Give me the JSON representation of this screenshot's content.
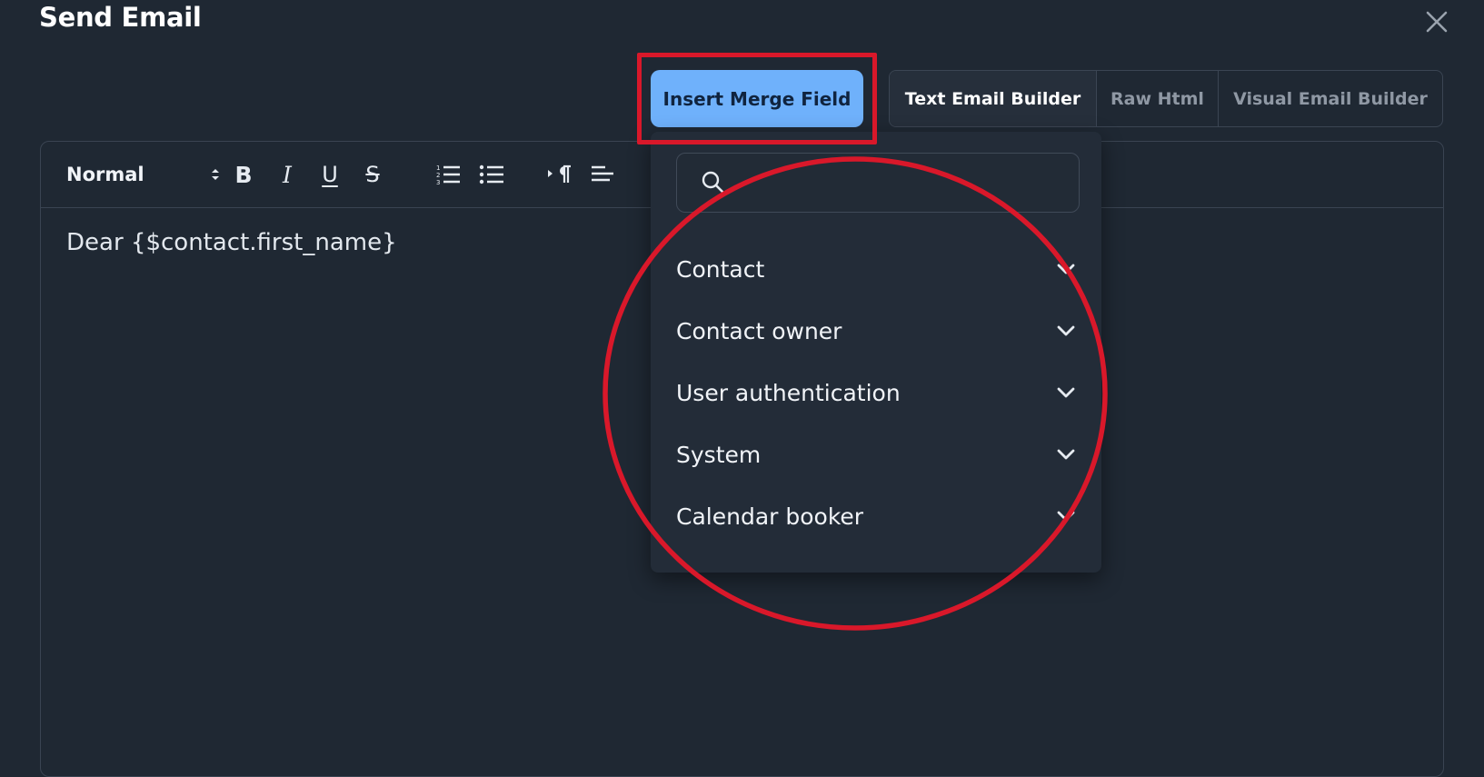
{
  "modal": {
    "title": "Send Email",
    "close_icon": "close-icon"
  },
  "insert_merge_button": "Insert Merge Field",
  "mode_tabs": [
    {
      "label": "Text Email Builder",
      "active": true
    },
    {
      "label": "Raw Html",
      "active": false
    },
    {
      "label": "Visual Email Builder",
      "active": false
    }
  ],
  "toolbar": {
    "format_value": "Normal",
    "buttons": [
      {
        "icon": "bold-icon",
        "glyph": "B"
      },
      {
        "icon": "italic-icon",
        "glyph": "I"
      },
      {
        "icon": "underline-icon",
        "glyph": "U"
      },
      {
        "icon": "strikethrough-icon",
        "glyph": "S"
      },
      {
        "icon": "ordered-list-icon"
      },
      {
        "icon": "bullet-list-icon"
      },
      {
        "icon": "text-direction-icon"
      },
      {
        "icon": "align-left-icon"
      }
    ]
  },
  "editor": {
    "body_text": "Dear {$contact.first_name}"
  },
  "merge_dropdown": {
    "search_placeholder": "",
    "categories": [
      {
        "label": "Contact",
        "icon": "chevron-down-icon"
      },
      {
        "label": "Contact owner",
        "icon": "chevron-down-icon"
      },
      {
        "label": "User authentication",
        "icon": "chevron-down-icon"
      },
      {
        "label": "System",
        "icon": "chevron-down-icon"
      },
      {
        "label": "Calendar booker",
        "icon": "chevron-down-icon"
      }
    ]
  },
  "colors": {
    "background": "#1f2833",
    "primary_button": "#6fb1fb",
    "annotation_red": "#d9182a"
  }
}
